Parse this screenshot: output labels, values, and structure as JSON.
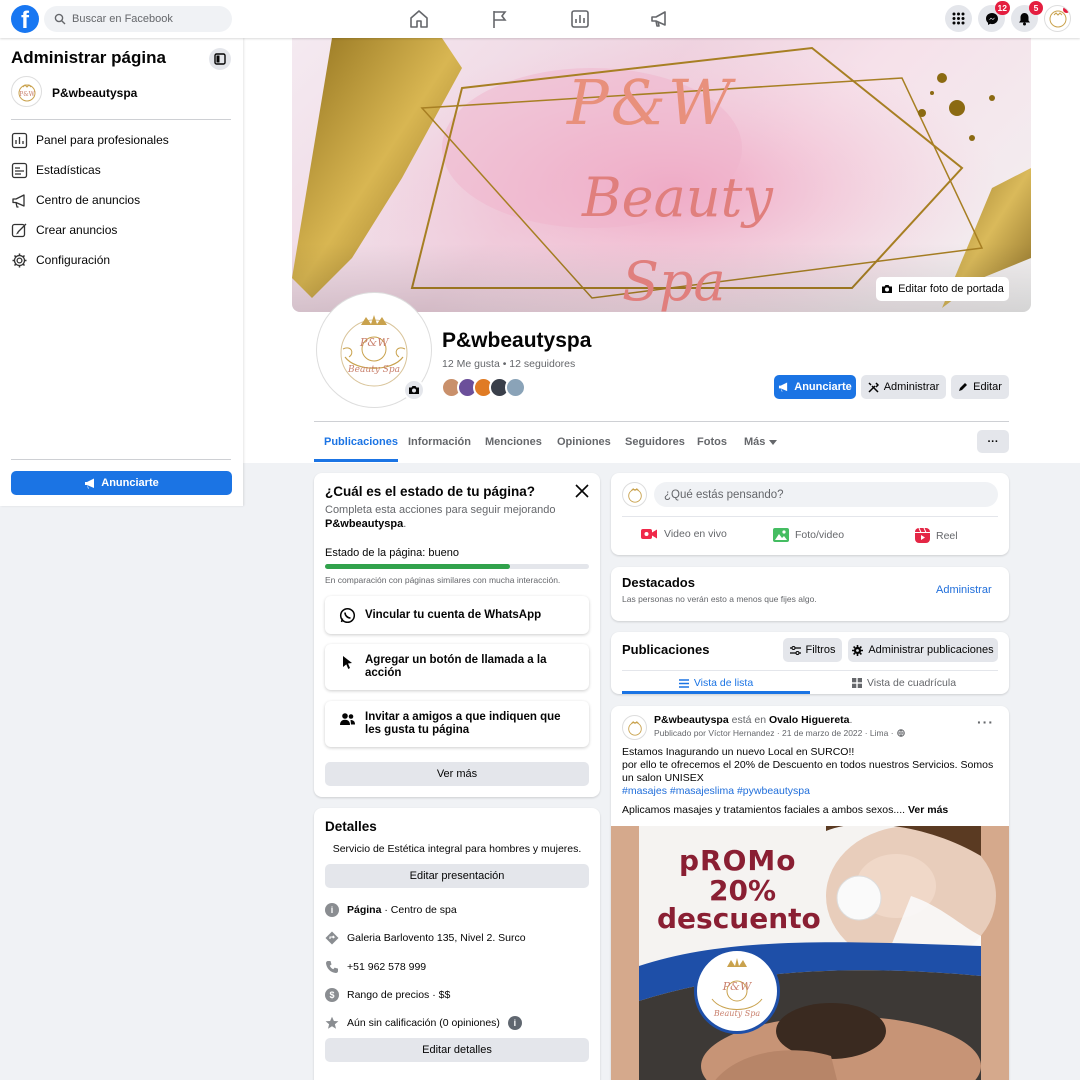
{
  "topbar": {
    "logo": "f",
    "search_placeholder": "Buscar en Facebook",
    "nav_icons": [
      "home-icon",
      "flag-icon",
      "chart-icon",
      "megaphone-icon"
    ],
    "messenger_badge": "12",
    "notifications_badge": "5"
  },
  "sidebar": {
    "title": "Administrar página",
    "page_name": "P&wbeautyspa",
    "items": [
      {
        "label": "Panel para profesionales",
        "icon": "dashboard-icon"
      },
      {
        "label": "Estadísticas",
        "icon": "stats-icon"
      },
      {
        "label": "Centro de anuncios",
        "icon": "megaphone-icon"
      },
      {
        "label": "Crear anuncios",
        "icon": "pencil-icon"
      },
      {
        "label": "Configuración",
        "icon": "gear-icon"
      }
    ],
    "promote_button": "Anunciarte"
  },
  "cover": {
    "line1": "P&W",
    "line2": "Beauty",
    "line3": "Spa",
    "edit_button": "Editar foto de portada"
  },
  "profile": {
    "name": "P&wbeautyspa",
    "stats": "12 Me gusta • 12 seguidores",
    "logo_text": "P&W",
    "logo_sub": "Beauty Spa",
    "buttons": {
      "promote": "Anunciarte",
      "manage": "Administrar",
      "edit": "Editar"
    },
    "tabs": [
      "Publicaciones",
      "Información",
      "Menciones",
      "Opiniones",
      "Seguidores",
      "Fotos",
      "Más"
    ],
    "active_tab": "Publicaciones",
    "more_button": "···"
  },
  "status_card": {
    "title": "¿Cuál es el estado de tu página?",
    "subtitle_prefix": "Completa esta acciones para seguir mejorando",
    "subtitle_name": "P&wbeautyspa",
    "subtitle_suffix": ".",
    "status_label": "Estado de la página: bueno",
    "progress": 0.7,
    "comparison": "En comparación con páginas similares con mucha interacción.",
    "actions": [
      {
        "label": "Vincular tu cuenta de WhatsApp",
        "icon": "whatsapp-icon"
      },
      {
        "label": "Agregar un botón de llamada a la acción",
        "icon": "cursor-icon"
      },
      {
        "label": "Invitar a amigos a que indiquen que les gusta tu página",
        "icon": "people-icon"
      }
    ],
    "see_more": "Ver más"
  },
  "details_card": {
    "title": "Detalles",
    "description": "Servicio de Estética integral para hombres y mujeres.",
    "edit_presentation": "Editar presentación",
    "rows": [
      {
        "bold": "Página",
        "text": " · Centro de spa",
        "icon": "info-icon"
      },
      {
        "bold": "",
        "text": "Galeria Barlovento 135, Nivel 2. Surco",
        "icon": "location-icon"
      },
      {
        "bold": "",
        "text": "+51 962 578 999",
        "icon": "phone-icon"
      },
      {
        "bold": "",
        "text": "Rango de precios · $$",
        "icon": "price-icon"
      },
      {
        "bold": "",
        "text": "Aún sin calificación (0 opiniones)",
        "icon": "star-icon"
      }
    ],
    "edit_details": "Editar detalles"
  },
  "composer": {
    "placeholder": "¿Qué estás pensando?",
    "actions": [
      {
        "label": "Video en vivo",
        "color": "#f02849"
      },
      {
        "label": "Foto/video",
        "color": "#45bd62"
      },
      {
        "label": "Reel",
        "color": "#e42645"
      }
    ]
  },
  "featured": {
    "title": "Destacados",
    "subtitle": "Las personas no verán esto a menos que fijes algo.",
    "manage": "Administrar"
  },
  "posts_header": {
    "title": "Publicaciones",
    "filters": "Filtros",
    "manage_posts": "Administrar publicaciones",
    "list_view": "Vista de lista",
    "grid_view": "Vista de cuadrícula"
  },
  "post": {
    "author": "P&wbeautyspa",
    "at_text": " está en ",
    "place": "Ovalo Higuereta",
    "meta": "Publicado por Víctor Hernandez · 21 de marzo de 2022 · Lima ·",
    "text1": "Estamos Inagurando un nuevo Local en SURCO!!",
    "text2": "por ello te ofrecemos el 20% de Descuento en todos nuestros Servicios. Somos un salon UNISEX",
    "hashtags": "#masajes  #masajeslima #pywbeautyspa",
    "text3": "Aplicamos masajes y tratamientos faciales a ambos sexos....",
    "see_more": "Ver más",
    "promo_line1": "pROMo",
    "promo_line2": "20%",
    "promo_line3": "descuento",
    "promo_logo": "P&W",
    "promo_logo_sub": "Beauty Spa"
  },
  "colors": {
    "brand": "#1877f2",
    "progress": "#31a24c",
    "link": "#216fdb"
  }
}
